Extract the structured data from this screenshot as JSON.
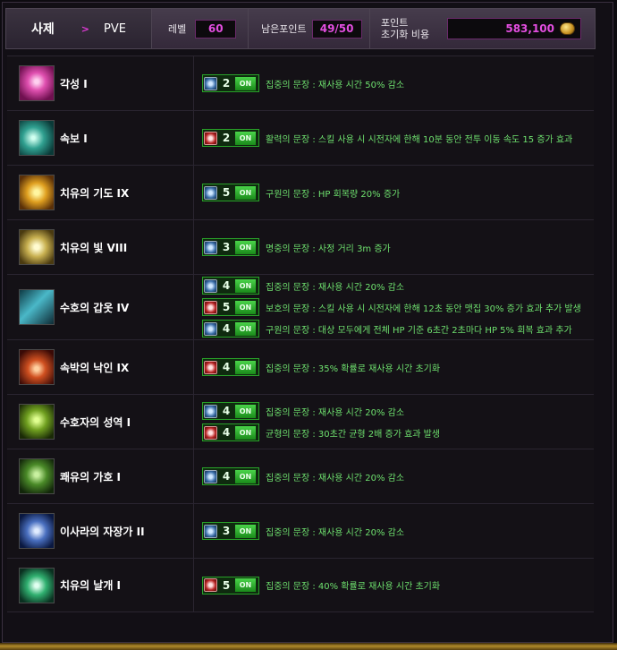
{
  "header": {
    "class_name": "사제",
    "arrow": ">",
    "mode": "PVE",
    "level_label": "레벨",
    "level_value": "60",
    "points_label": "남은포인트",
    "points_value": "49/50",
    "cost_label_1": "포인트",
    "cost_label_2": "초기화 비용",
    "cost_value": "583,100",
    "coin_icon": "gold-coin-icon"
  },
  "glyph_on_label": "ON",
  "skills": [
    {
      "name": "각성 I",
      "icon": "awakening-skill-icon",
      "glyphs": [
        {
          "level": "2",
          "type": "blue",
          "desc": "집중의 문장 : 재사용 시간 50% 감소"
        }
      ]
    },
    {
      "name": "속보 I",
      "icon": "haste-skill-icon",
      "glyphs": [
        {
          "level": "2",
          "type": "red",
          "desc": "활력의 문장 : 스킬 사용 시 시전자에 한해 10분 동안 전투 이동 속도 15 증가 효과"
        }
      ]
    },
    {
      "name": "치유의 기도 IX",
      "icon": "healing-prayer-skill-icon",
      "glyphs": [
        {
          "level": "5",
          "type": "blue",
          "desc": "구원의 문장 : HP 회복량 20% 증가"
        }
      ]
    },
    {
      "name": "치유의 빛 VIII",
      "icon": "healing-light-skill-icon",
      "glyphs": [
        {
          "level": "3",
          "type": "blue",
          "desc": "명중의 문장 : 사정 거리 3m 증가"
        }
      ]
    },
    {
      "name": "수호의 갑옷 IV",
      "icon": "guardian-armor-skill-icon",
      "glyphs": [
        {
          "level": "4",
          "type": "blue",
          "desc": "집중의 문장 : 재사용 시간 20% 감소"
        },
        {
          "level": "5",
          "type": "red",
          "desc": "보호의 문장 : 스킬 사용 시 시전자에 한해 12초 동안 맷집 30% 증가 효과 추가 발생"
        },
        {
          "level": "4",
          "type": "blue",
          "desc": "구원의 문장 : 대상 모두에게 전체 HP 기준 6초간 2초마다 HP 5% 회복 효과 추가"
        }
      ]
    },
    {
      "name": "속박의 낙인 IX",
      "icon": "binding-mark-skill-icon",
      "glyphs": [
        {
          "level": "4",
          "type": "red",
          "desc": "집중의 문장 : 35% 확률로 재사용 시간 초기화"
        }
      ]
    },
    {
      "name": "수호자의 성역 I",
      "icon": "guardian-sanctuary-skill-icon",
      "glyphs": [
        {
          "level": "4",
          "type": "blue",
          "desc": "집중의 문장 : 재사용 시간 20% 감소"
        },
        {
          "level": "4",
          "type": "red",
          "desc": "균형의 문장 : 30초간 균형 2배 증가 효과 발생"
        }
      ]
    },
    {
      "name": "쾌유의 가호 I",
      "icon": "recovery-blessing-skill-icon",
      "glyphs": [
        {
          "level": "4",
          "type": "blue",
          "desc": "집중의 문장 : 재사용 시간 20% 감소"
        }
      ]
    },
    {
      "name": "이사라의 자장가 II",
      "icon": "lullaby-skill-icon",
      "glyphs": [
        {
          "level": "3",
          "type": "blue",
          "desc": "집중의 문장 : 재사용 시간 20% 감소"
        }
      ]
    },
    {
      "name": "치유의 날개 I",
      "icon": "healing-wings-skill-icon",
      "glyphs": [
        {
          "level": "5",
          "type": "red",
          "desc": "집중의 문장 : 40% 확률로 재사용 시간 초기화"
        }
      ]
    }
  ]
}
